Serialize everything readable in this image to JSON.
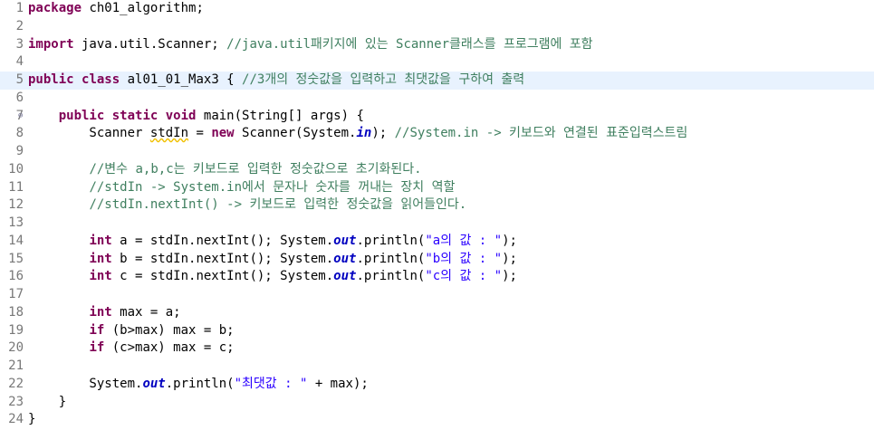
{
  "editor": {
    "current_line": 5,
    "fold_marker_line": 7,
    "lines": [
      {
        "num": "1",
        "tokens": [
          [
            "kw",
            "package"
          ],
          [
            "pl",
            " ch01_algorithm;"
          ]
        ]
      },
      {
        "num": "2",
        "tokens": []
      },
      {
        "num": "3",
        "tokens": [
          [
            "kw",
            "import"
          ],
          [
            "pl",
            " java.util.Scanner; "
          ],
          [
            "cm",
            "//java.util패키지에 있는 Scanner클래스를 프로그램에 포함"
          ]
        ]
      },
      {
        "num": "4",
        "tokens": []
      },
      {
        "num": "5",
        "tokens": [
          [
            "kw",
            "public"
          ],
          [
            "pl",
            " "
          ],
          [
            "kw",
            "class"
          ],
          [
            "pl",
            " al01_01_Max3 { "
          ],
          [
            "cm",
            "//3개의 정숫값을 입력하고 최댓값을 구하여 출력"
          ]
        ]
      },
      {
        "num": "6",
        "tokens": []
      },
      {
        "num": "7",
        "tokens": [
          [
            "pl",
            "    "
          ],
          [
            "kw",
            "public"
          ],
          [
            "pl",
            " "
          ],
          [
            "kw",
            "static"
          ],
          [
            "pl",
            " "
          ],
          [
            "kw",
            "void"
          ],
          [
            "pl",
            " main(String[] args) {"
          ]
        ]
      },
      {
        "num": "8",
        "tokens": [
          [
            "pl",
            "        Scanner "
          ],
          [
            "sq",
            "stdIn"
          ],
          [
            "pl",
            " = "
          ],
          [
            "kw",
            "new"
          ],
          [
            "pl",
            " Scanner(System."
          ],
          [
            "fld",
            "in"
          ],
          [
            "pl",
            "); "
          ],
          [
            "cm",
            "//System.in -> 키보드와 연결된 표준입력스트림"
          ]
        ]
      },
      {
        "num": "9",
        "tokens": []
      },
      {
        "num": "10",
        "tokens": [
          [
            "pl",
            "        "
          ],
          [
            "cm",
            "//변수 a,b,c는 키보드로 입력한 정숫값으로 초기화된다."
          ]
        ]
      },
      {
        "num": "11",
        "tokens": [
          [
            "pl",
            "        "
          ],
          [
            "cm",
            "//stdIn -> System.in에서 문자나 숫자를 꺼내는 장치 역할"
          ]
        ]
      },
      {
        "num": "12",
        "tokens": [
          [
            "pl",
            "        "
          ],
          [
            "cm",
            "//stdIn.nextInt() -> 키보드로 입력한 정숫값을 읽어들인다."
          ]
        ]
      },
      {
        "num": "13",
        "tokens": []
      },
      {
        "num": "14",
        "tokens": [
          [
            "pl",
            "        "
          ],
          [
            "kw",
            "int"
          ],
          [
            "pl",
            " a = stdIn.nextInt(); System."
          ],
          [
            "fld",
            "out"
          ],
          [
            "pl",
            ".println("
          ],
          [
            "st",
            "\"a의 값 : \""
          ],
          [
            "pl",
            ");"
          ]
        ]
      },
      {
        "num": "15",
        "tokens": [
          [
            "pl",
            "        "
          ],
          [
            "kw",
            "int"
          ],
          [
            "pl",
            " b = stdIn.nextInt(); System."
          ],
          [
            "fld",
            "out"
          ],
          [
            "pl",
            ".println("
          ],
          [
            "st",
            "\"b의 값 : \""
          ],
          [
            "pl",
            ");"
          ]
        ]
      },
      {
        "num": "16",
        "tokens": [
          [
            "pl",
            "        "
          ],
          [
            "kw",
            "int"
          ],
          [
            "pl",
            " c = stdIn.nextInt(); System."
          ],
          [
            "fld",
            "out"
          ],
          [
            "pl",
            ".println("
          ],
          [
            "st",
            "\"c의 값 : \""
          ],
          [
            "pl",
            ");"
          ]
        ]
      },
      {
        "num": "17",
        "tokens": []
      },
      {
        "num": "18",
        "tokens": [
          [
            "pl",
            "        "
          ],
          [
            "kw",
            "int"
          ],
          [
            "pl",
            " max = a;"
          ]
        ]
      },
      {
        "num": "19",
        "tokens": [
          [
            "pl",
            "        "
          ],
          [
            "kw",
            "if"
          ],
          [
            "pl",
            " (b>max) max = b;"
          ]
        ]
      },
      {
        "num": "20",
        "tokens": [
          [
            "pl",
            "        "
          ],
          [
            "kw",
            "if"
          ],
          [
            "pl",
            " (c>max) max = c;"
          ]
        ]
      },
      {
        "num": "21",
        "tokens": []
      },
      {
        "num": "22",
        "tokens": [
          [
            "pl",
            "        System."
          ],
          [
            "fld",
            "out"
          ],
          [
            "pl",
            ".println("
          ],
          [
            "st",
            "\"최댓값 : \""
          ],
          [
            "pl",
            " + max);"
          ]
        ]
      },
      {
        "num": "23",
        "tokens": [
          [
            "pl",
            "    }"
          ]
        ]
      },
      {
        "num": "24",
        "tokens": [
          [
            "pl",
            "}"
          ]
        ]
      }
    ]
  },
  "icons": {
    "fold": "fold-collapse-icon"
  }
}
